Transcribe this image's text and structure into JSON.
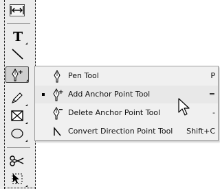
{
  "toolbox": {
    "tools": [
      {
        "name": "vertical-type-resize-tool",
        "icon": "horizontal-arrows-icon"
      },
      {
        "name": "type-tool",
        "icon": "type-t-icon"
      },
      {
        "name": "line-segment-tool",
        "icon": "line-icon"
      },
      {
        "name": "pen-tool",
        "icon": "pen-add-icon",
        "active": true
      },
      {
        "name": "pencil-tool",
        "icon": "pencil-icon"
      },
      {
        "name": "rectangle-frame-tool",
        "icon": "frame-x-icon"
      },
      {
        "name": "ellipse-tool",
        "icon": "ellipse-icon"
      },
      {
        "name": "scissors-tool",
        "icon": "scissors-icon"
      },
      {
        "name": "free-transform-tool",
        "icon": "transform-icon"
      }
    ]
  },
  "flyout": {
    "items": [
      {
        "label": "Pen Tool",
        "shortcut": "P",
        "icon": "pen-icon",
        "selected": false
      },
      {
        "label": "Add Anchor Point Tool",
        "shortcut": "=",
        "icon": "pen-plus-icon",
        "selected": true
      },
      {
        "label": "Delete Anchor Point Tool",
        "shortcut": "-",
        "icon": "pen-minus-icon",
        "selected": false
      },
      {
        "label": "Convert Direction Point Tool",
        "shortcut": "Shift+C",
        "icon": "convert-direction-icon",
        "selected": false
      }
    ]
  },
  "colors": {
    "toolbox_bg": "#ececec",
    "menu_bg": "#f0f0f0",
    "menu_border": "#9a9a9a",
    "text": "#111111"
  }
}
